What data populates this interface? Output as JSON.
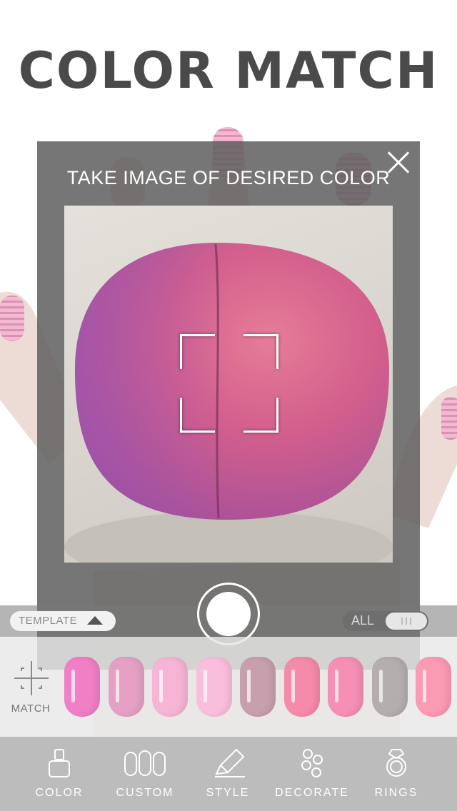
{
  "header": {
    "title": "COLOR MATCH"
  },
  "capture_dialog": {
    "instruction": "TAKE IMAGE OF DESIRED COLOR",
    "close_icon": "close-icon",
    "focus_icon": "focus-frame-icon",
    "shutter_icon": "shutter-icon"
  },
  "filter_bar": {
    "template_label": "TEMPLATE",
    "template_icon": "triangle-up-icon",
    "all_label": "ALL",
    "all_toggle_on": true
  },
  "match": {
    "label": "MATCH",
    "icon": "crosshair-icon"
  },
  "swatches": [
    {
      "color": "#f07fc6"
    },
    {
      "color": "#e6a0c4"
    },
    {
      "color": "#f6b5d5"
    },
    {
      "color": "#f9bedb"
    },
    {
      "color": "#c8a0ad"
    },
    {
      "color": "#f58aaa"
    },
    {
      "color": "#f58fb5"
    },
    {
      "color": "#b4aeae"
    },
    {
      "color": "#fa9ab3"
    }
  ],
  "tabs": [
    {
      "label": "COLOR",
      "icon": "nail-polish-icon"
    },
    {
      "label": "CUSTOM",
      "icon": "nails-icon"
    },
    {
      "label": "STYLE",
      "icon": "brush-icon"
    },
    {
      "label": "DECORATE",
      "icon": "gems-icon"
    },
    {
      "label": "RINGS",
      "icon": "ring-icon"
    }
  ],
  "colors": {
    "title": "#4a4a4a",
    "overlay": "#5f5f5f",
    "tabbar": "#bcbcbc",
    "ball": "#d9608e"
  }
}
